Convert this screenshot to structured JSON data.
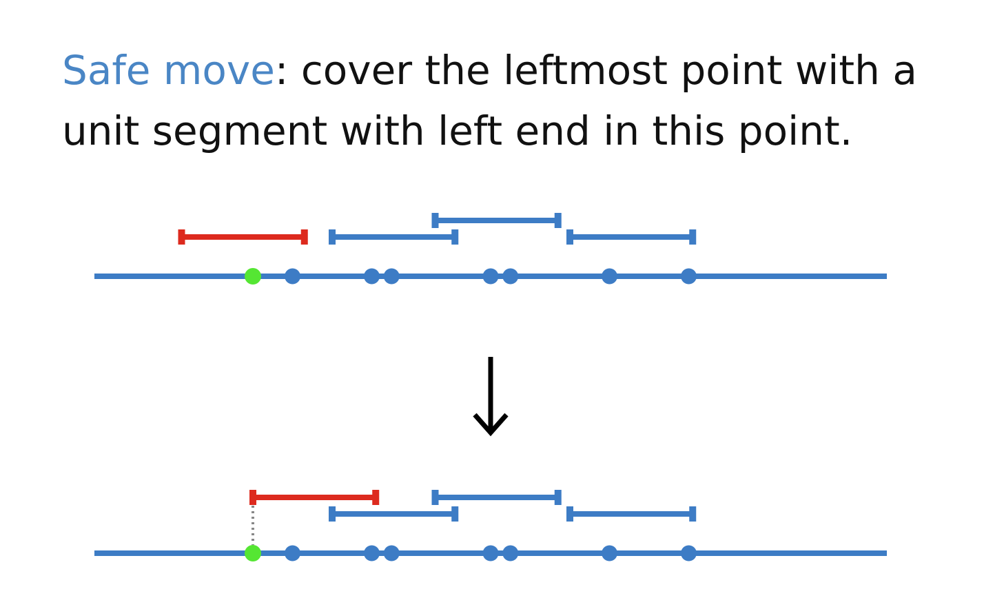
{
  "slide": {
    "highlight": "Safe move",
    "text_line1": ": cover the leftmost point with a",
    "text_line2": "unit segment with left end in this point."
  },
  "colors": {
    "accent_blue": "#4a86c5",
    "line_blue": "#3d7cc5",
    "segment_red": "#dd2a1e",
    "point_green": "#55e633",
    "arrow": "#000000",
    "dotted": "#888888"
  },
  "diagram": {
    "points": [
      0,
      1,
      3,
      3.5,
      6,
      6.5,
      9,
      11
    ],
    "leftmost_point": 0,
    "before": {
      "segments": [
        {
          "left": -1.8,
          "right": 1.3,
          "color": "red"
        },
        {
          "left": 2.0,
          "right": 5.1,
          "color": "blue"
        },
        {
          "left": 4.6,
          "right": 7.7,
          "color": "blue"
        },
        {
          "left": 8.0,
          "right": 11.1,
          "color": "blue"
        }
      ]
    },
    "after": {
      "segments": [
        {
          "left": 0,
          "right": 3.1,
          "color": "red"
        },
        {
          "left": 2.0,
          "right": 5.1,
          "color": "blue"
        },
        {
          "left": 4.6,
          "right": 7.7,
          "color": "blue"
        },
        {
          "left": 8.0,
          "right": 11.1,
          "color": "blue"
        }
      ]
    }
  }
}
